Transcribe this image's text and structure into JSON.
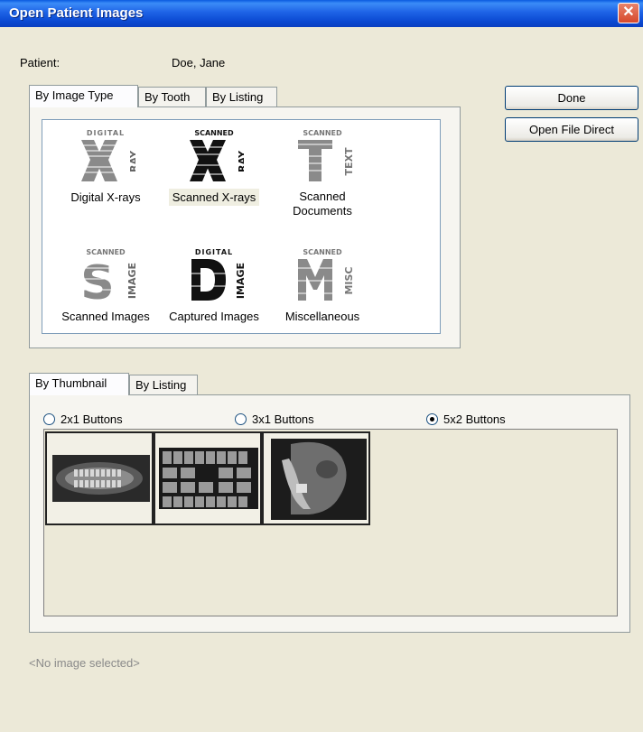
{
  "window": {
    "title": "Open Patient Images",
    "close_glyph": "✕"
  },
  "patient": {
    "label": "Patient:",
    "name": "Doe, Jane"
  },
  "top_tabs": [
    "By Image Type",
    "By Tooth",
    "By Listing"
  ],
  "buttons": {
    "done": "Done",
    "open_file_direct": "Open File Direct"
  },
  "image_types": [
    {
      "label": "Digital X-rays",
      "badge_top": "DIGITAL",
      "big_letter": "X",
      "side_text": "RAY",
      "selected": false
    },
    {
      "label": "Scanned X-rays",
      "badge_top": "SCANNED",
      "big_letter": "X",
      "side_text": "RAY",
      "selected": true
    },
    {
      "label_line1": "Scanned",
      "label_line2": "Documents",
      "badge_top": "SCANNED",
      "big_letter": "T",
      "side_text": "TEXT",
      "selected": false
    },
    {
      "label": "Scanned Images",
      "badge_top": "SCANNED",
      "big_letter": "S",
      "side_text": "IMAGE",
      "selected": false
    },
    {
      "label": "Captured Images",
      "badge_top": "DIGITAL",
      "big_letter": "D",
      "side_text": "IMAGE",
      "selected": false
    },
    {
      "label": "Miscellaneous",
      "badge_top": "SCANNED",
      "big_letter": "M",
      "side_text": "MISC",
      "selected": false
    }
  ],
  "bottom_tabs": [
    "By Thumbnail",
    "By Listing"
  ],
  "layout_options": [
    {
      "label": "2x1 Buttons",
      "selected": false
    },
    {
      "label": "3x1 Buttons",
      "selected": false
    },
    {
      "label": "5x2 Buttons",
      "selected": true
    }
  ],
  "thumbnails": [
    {
      "name": "panoramic-xray-thumbnail"
    },
    {
      "name": "full-mouth-series-thumbnail"
    },
    {
      "name": "cephalometric-xray-thumbnail"
    }
  ],
  "status": {
    "selection_text": "<No image selected>"
  },
  "colors": {
    "title_bar": "#0a48d1",
    "dialog_bg": "#ece9d8",
    "close_button": "#d6482b"
  }
}
